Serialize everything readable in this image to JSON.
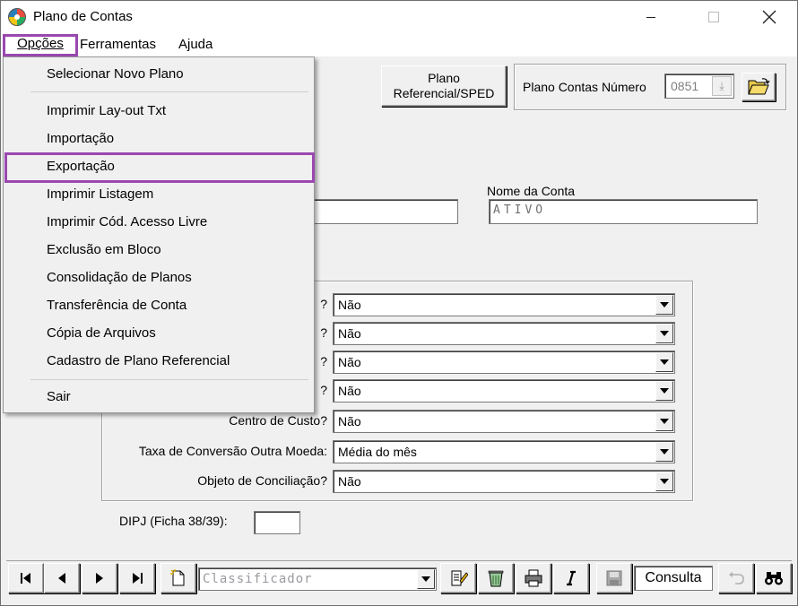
{
  "window": {
    "title": "Plano de Contas"
  },
  "menubar": {
    "opcoes": "Opções",
    "ferramentas": "Ferramentas",
    "ajuda": "Ajuda"
  },
  "toolbar": {
    "plano_ref_line1": "Plano",
    "plano_ref_line2": "Referencial/SPED",
    "plano_contas_label": "Plano Contas Número",
    "plano_contas_value": "0851"
  },
  "form": {
    "nome_conta_label": "Nome da Conta",
    "nome_conta_value": "ATIVO",
    "options": [
      {
        "label": "?",
        "value": "Não"
      },
      {
        "label": "?",
        "value": "Não"
      },
      {
        "label": "?",
        "value": "Não"
      },
      {
        "label": "?",
        "value": "Não"
      },
      {
        "label": "Centro de Custo?",
        "value": "Não"
      },
      {
        "label": "Taxa de Conversão Outra Moeda:",
        "value": "Média do mês"
      },
      {
        "label": "Objeto de Conciliação?",
        "value": "Não"
      }
    ],
    "dipj_label": "DIPJ (Ficha 38/39):",
    "dipj_value": ""
  },
  "bottom_bar": {
    "classificador_placeholder": "Classificador",
    "mode": "Consulta"
  },
  "dropdown": {
    "items": [
      "Selecionar Novo Plano",
      "Imprimir Lay-out Txt",
      "Importação",
      "Exportação",
      "Imprimir Listagem",
      "Imprimir Cód. Acesso Livre",
      "Exclusão em Bloco",
      "Consolidação de Planos",
      "Transferência de Conta",
      "Cópia de Arquivos",
      "Cadastro de Plano Referencial",
      "Sair"
    ]
  },
  "colors": {
    "highlight": "#9a48b0",
    "face": "#f0f0f0"
  }
}
